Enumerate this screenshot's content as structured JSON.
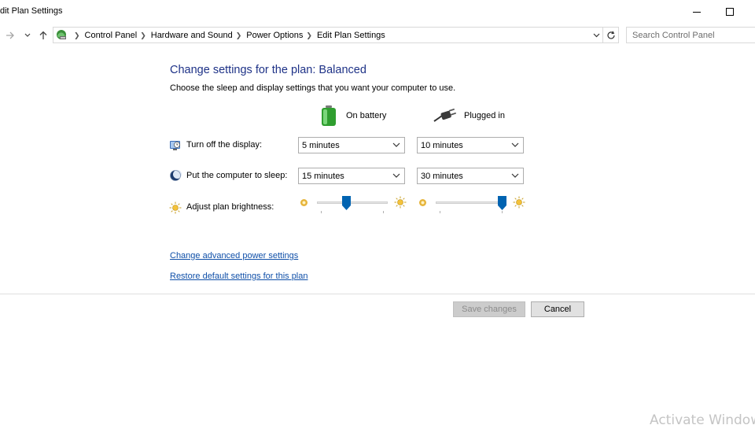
{
  "window": {
    "title": "Edit Plan Settings",
    "visible_title": "dit Plan Settings"
  },
  "nav": {
    "back_forward_icon": "forward-arrow-icon",
    "recent_icon": "chevron-down-icon",
    "up_icon": "up-arrow-icon",
    "breadcrumbs": [
      "Control Panel",
      "Hardware and Sound",
      "Power Options",
      "Edit Plan Settings"
    ],
    "search_placeholder": "Search Control Panel"
  },
  "main": {
    "heading": "Change settings for the plan: Balanced",
    "subheading": "Choose the sleep and display settings that you want your computer to use.",
    "columns": {
      "battery": "On battery",
      "plugged": "Plugged in"
    },
    "rows": {
      "display": {
        "label": "Turn off the display:",
        "battery_value": "5 minutes",
        "plugged_value": "10 minutes"
      },
      "sleep": {
        "label": "Put the computer to sleep:",
        "battery_value": "15 minutes",
        "plugged_value": "30 minutes"
      },
      "brightness": {
        "label": "Adjust plan brightness:",
        "battery_level": 0.4,
        "plugged_level": 1.0
      }
    },
    "links": {
      "advanced": "Change advanced power settings",
      "restore": "Restore default settings for this plan"
    }
  },
  "footer": {
    "save_label": "Save changes",
    "cancel_label": "Cancel"
  },
  "watermark": "Activate Windows",
  "colors": {
    "heading": "#1e3287",
    "link": "#0f4fa8",
    "slider_thumb": "#0063b1"
  }
}
